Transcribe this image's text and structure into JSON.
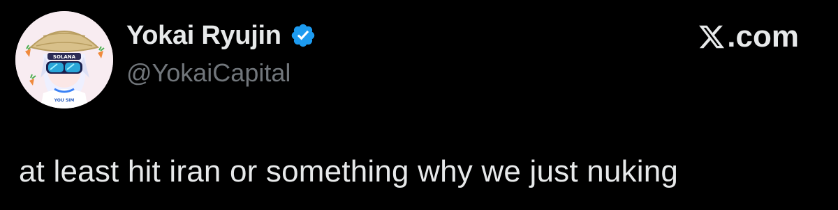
{
  "author": {
    "display_name": "Yokai Ryujin",
    "handle": "@YokaiCapital",
    "verified": true,
    "avatar_icon": "anime-avatar-straw-hat",
    "avatar_hat_text": "SOLANA",
    "avatar_shirt_text": "YOU SIM"
  },
  "brand": {
    "label": ".com",
    "icon": "x-logo-icon"
  },
  "post": {
    "text": "at least hit iran or something why we just nuking"
  },
  "colors": {
    "background": "#000000",
    "primary_text": "#e7e9ea",
    "secondary_text": "#71767b",
    "verified_blue": "#1d9bf0"
  }
}
